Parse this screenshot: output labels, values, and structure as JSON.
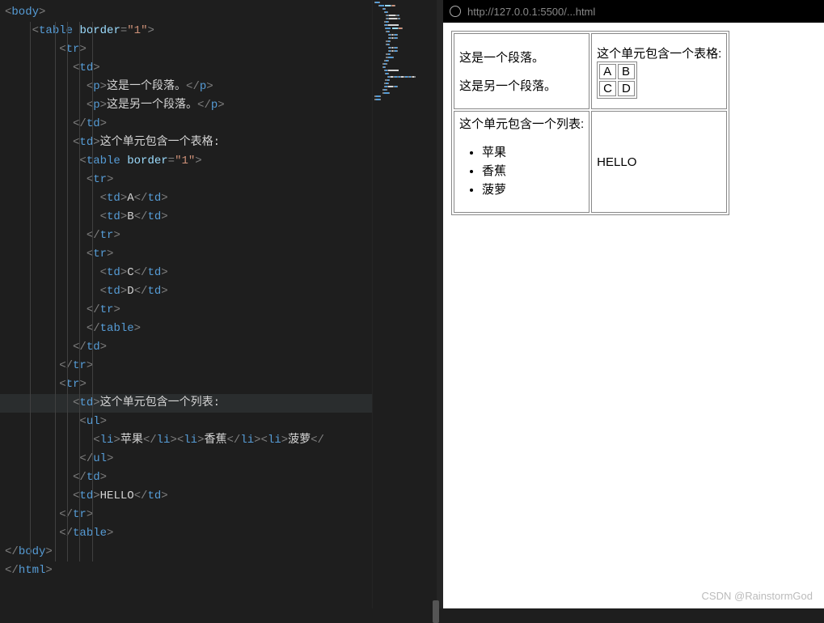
{
  "code": {
    "lines": [
      [
        [
          "brk",
          "<"
        ],
        [
          "tag",
          "body"
        ],
        [
          "brk",
          ">"
        ]
      ],
      [
        [
          "txt",
          "    "
        ],
        [
          "brk",
          "<"
        ],
        [
          "tag",
          "table"
        ],
        [
          "txt",
          " "
        ],
        [
          "attr",
          "border"
        ],
        [
          "brk",
          "="
        ],
        [
          "str",
          "\"1\""
        ],
        [
          "brk",
          ">"
        ]
      ],
      [
        [
          "txt",
          "        "
        ],
        [
          "brk",
          "<"
        ],
        [
          "tag",
          "tr"
        ],
        [
          "brk",
          ">"
        ]
      ],
      [
        [
          "txt",
          "          "
        ],
        [
          "brk",
          "<"
        ],
        [
          "tag",
          "td"
        ],
        [
          "brk",
          ">"
        ]
      ],
      [
        [
          "txt",
          "            "
        ],
        [
          "brk",
          "<"
        ],
        [
          "tag",
          "p"
        ],
        [
          "brk",
          ">"
        ],
        [
          "txt",
          "这是一个段落。"
        ],
        [
          "brk",
          "</"
        ],
        [
          "tag",
          "p"
        ],
        [
          "brk",
          ">"
        ]
      ],
      [
        [
          "txt",
          "            "
        ],
        [
          "brk",
          "<"
        ],
        [
          "tag",
          "p"
        ],
        [
          "brk",
          ">"
        ],
        [
          "txt",
          "这是另一个段落。"
        ],
        [
          "brk",
          "</"
        ],
        [
          "tag",
          "p"
        ],
        [
          "brk",
          ">"
        ]
      ],
      [
        [
          "txt",
          "          "
        ],
        [
          "brk",
          "</"
        ],
        [
          "tag",
          "td"
        ],
        [
          "brk",
          ">"
        ]
      ],
      [
        [
          "txt",
          "          "
        ],
        [
          "brk",
          "<"
        ],
        [
          "tag",
          "td"
        ],
        [
          "brk",
          ">"
        ],
        [
          "txt",
          "这个单元包含一个表格:"
        ]
      ],
      [
        [
          "txt",
          "           "
        ],
        [
          "brk",
          "<"
        ],
        [
          "tag",
          "table"
        ],
        [
          "txt",
          " "
        ],
        [
          "attr",
          "border"
        ],
        [
          "brk",
          "="
        ],
        [
          "str",
          "\"1\""
        ],
        [
          "brk",
          ">"
        ]
      ],
      [
        [
          "txt",
          "            "
        ],
        [
          "brk",
          "<"
        ],
        [
          "tag",
          "tr"
        ],
        [
          "brk",
          ">"
        ]
      ],
      [
        [
          "txt",
          "              "
        ],
        [
          "brk",
          "<"
        ],
        [
          "tag",
          "td"
        ],
        [
          "brk",
          ">"
        ],
        [
          "txt",
          "A"
        ],
        [
          "brk",
          "</"
        ],
        [
          "tag",
          "td"
        ],
        [
          "brk",
          ">"
        ]
      ],
      [
        [
          "txt",
          "              "
        ],
        [
          "brk",
          "<"
        ],
        [
          "tag",
          "td"
        ],
        [
          "brk",
          ">"
        ],
        [
          "txt",
          "B"
        ],
        [
          "brk",
          "</"
        ],
        [
          "tag",
          "td"
        ],
        [
          "brk",
          ">"
        ]
      ],
      [
        [
          "txt",
          "            "
        ],
        [
          "brk",
          "</"
        ],
        [
          "tag",
          "tr"
        ],
        [
          "brk",
          ">"
        ]
      ],
      [
        [
          "txt",
          "            "
        ],
        [
          "brk",
          "<"
        ],
        [
          "tag",
          "tr"
        ],
        [
          "brk",
          ">"
        ]
      ],
      [
        [
          "txt",
          "              "
        ],
        [
          "brk",
          "<"
        ],
        [
          "tag",
          "td"
        ],
        [
          "brk",
          ">"
        ],
        [
          "txt",
          "C"
        ],
        [
          "brk",
          "</"
        ],
        [
          "tag",
          "td"
        ],
        [
          "brk",
          ">"
        ]
      ],
      [
        [
          "txt",
          "              "
        ],
        [
          "brk",
          "<"
        ],
        [
          "tag",
          "td"
        ],
        [
          "brk",
          ">"
        ],
        [
          "txt",
          "D"
        ],
        [
          "brk",
          "</"
        ],
        [
          "tag",
          "td"
        ],
        [
          "brk",
          ">"
        ]
      ],
      [
        [
          "txt",
          "            "
        ],
        [
          "brk",
          "</"
        ],
        [
          "tag",
          "tr"
        ],
        [
          "brk",
          ">"
        ]
      ],
      [
        [
          "txt",
          "            "
        ],
        [
          "brk",
          "</"
        ],
        [
          "tag",
          "table"
        ],
        [
          "brk",
          ">"
        ]
      ],
      [
        [
          "txt",
          "          "
        ],
        [
          "brk",
          "</"
        ],
        [
          "tag",
          "td"
        ],
        [
          "brk",
          ">"
        ]
      ],
      [
        [
          "txt",
          "        "
        ],
        [
          "brk",
          "</"
        ],
        [
          "tag",
          "tr"
        ],
        [
          "brk",
          ">"
        ]
      ],
      [
        [
          "txt",
          "        "
        ],
        [
          "brk",
          "<"
        ],
        [
          "tag",
          "tr"
        ],
        [
          "brk",
          ">"
        ]
      ],
      [
        [
          "txt",
          "          "
        ],
        [
          "brk",
          "<"
        ],
        [
          "tag",
          "td"
        ],
        [
          "brk",
          ">"
        ],
        [
          "txt",
          "这个单元包含一个列表:"
        ]
      ],
      [
        [
          "txt",
          "           "
        ],
        [
          "brk",
          "<"
        ],
        [
          "tag",
          "ul"
        ],
        [
          "brk",
          ">"
        ]
      ],
      [
        [
          "txt",
          "             "
        ],
        [
          "brk",
          "<"
        ],
        [
          "tag",
          "li"
        ],
        [
          "brk",
          ">"
        ],
        [
          "txt",
          "苹果"
        ],
        [
          "brk",
          "</"
        ],
        [
          "tag",
          "li"
        ],
        [
          "brk",
          ">"
        ],
        [
          "brk",
          "<"
        ],
        [
          "tag",
          "li"
        ],
        [
          "brk",
          ">"
        ],
        [
          "txt",
          "香蕉"
        ],
        [
          "brk",
          "</"
        ],
        [
          "tag",
          "li"
        ],
        [
          "brk",
          ">"
        ],
        [
          "brk",
          "<"
        ],
        [
          "tag",
          "li"
        ],
        [
          "brk",
          ">"
        ],
        [
          "txt",
          "菠萝"
        ],
        [
          "brk",
          "</"
        ]
      ],
      [
        [
          "txt",
          "           "
        ],
        [
          "brk",
          "</"
        ],
        [
          "tag",
          "ul"
        ],
        [
          "brk",
          ">"
        ]
      ],
      [
        [
          "txt",
          "          "
        ],
        [
          "brk",
          "</"
        ],
        [
          "tag",
          "td"
        ],
        [
          "brk",
          ">"
        ]
      ],
      [
        [
          "txt",
          "          "
        ],
        [
          "brk",
          "<"
        ],
        [
          "tag",
          "td"
        ],
        [
          "brk",
          ">"
        ],
        [
          "txt",
          "HELLO"
        ],
        [
          "brk",
          "</"
        ],
        [
          "tag",
          "td"
        ],
        [
          "brk",
          ">"
        ]
      ],
      [
        [
          "txt",
          "        "
        ],
        [
          "brk",
          "</"
        ],
        [
          "tag",
          "tr"
        ],
        [
          "brk",
          ">"
        ]
      ],
      [
        [
          "txt",
          "        "
        ],
        [
          "brk",
          "</"
        ],
        [
          "tag",
          "table"
        ],
        [
          "brk",
          ">"
        ]
      ],
      [
        [
          "brk",
          "</"
        ],
        [
          "tag",
          "body"
        ],
        [
          "brk",
          ">"
        ]
      ],
      [
        [
          "brk",
          "</"
        ],
        [
          "tag",
          "html"
        ],
        [
          "brk",
          ">"
        ]
      ]
    ],
    "cursor_line_index": 21
  },
  "browser": {
    "url": "http://127.0.0.1:5500/...html"
  },
  "page": {
    "cell1_p1": "这是一个段落。",
    "cell1_p2": "这是另一个段落。",
    "cell2_title": "这个单元包含一个表格:",
    "inner": {
      "a": "A",
      "b": "B",
      "c": "C",
      "d": "D"
    },
    "cell3_title": "这个单元包含一个列表:",
    "list": [
      "苹果",
      "香蕉",
      "菠萝"
    ],
    "cell4": "HELLO"
  },
  "watermark": "CSDN @RainstormGod"
}
